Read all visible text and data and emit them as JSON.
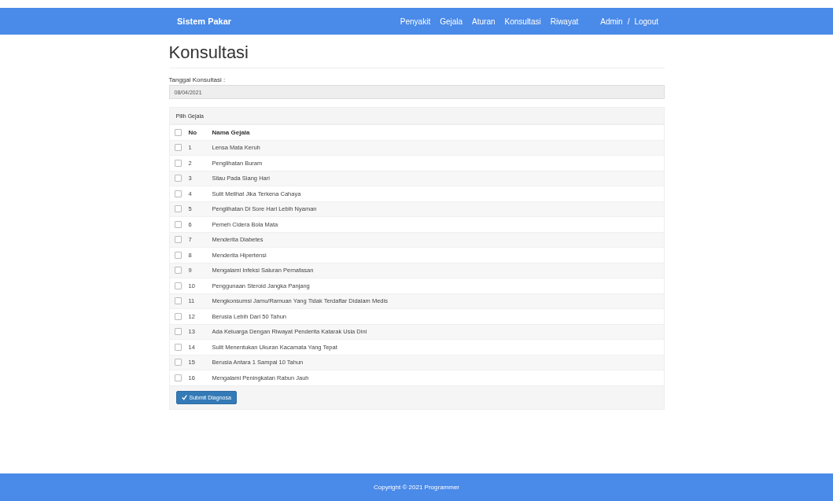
{
  "navbar": {
    "brand": "Sistem Pakar",
    "links": [
      "Penyakit",
      "Gejala",
      "Aturan",
      "Konsultasi",
      "Riwayat"
    ],
    "user": "Admin",
    "separator": "/",
    "logout": "Logout"
  },
  "page": {
    "title": "Konsultasi",
    "date_label": "Tanggal Konsultasi :",
    "date_value": "08/04/2021"
  },
  "panel": {
    "heading": "Pilih Gejala",
    "columns": [
      "No",
      "Nama Gejala"
    ],
    "all_checked": false,
    "rows": [
      {
        "no": "1",
        "name": "Lensa Mata Keruh",
        "checked": false
      },
      {
        "no": "2",
        "name": "Penglihatan Buram",
        "checked": false
      },
      {
        "no": "3",
        "name": "Silau Pada Siang Hari",
        "checked": false
      },
      {
        "no": "4",
        "name": "Sulit Melihat Jika Terkena Cahaya",
        "checked": false
      },
      {
        "no": "5",
        "name": "Penglihatan Di Sore Hari Lebih Nyaman",
        "checked": false
      },
      {
        "no": "6",
        "name": "Pemeh Cidera Bola Mata",
        "checked": false
      },
      {
        "no": "7",
        "name": "Menderita Diabetes",
        "checked": false
      },
      {
        "no": "8",
        "name": "Menderita Hipertensi",
        "checked": false
      },
      {
        "no": "9",
        "name": "Mengalami Infeksi Saluran Pernafasan",
        "checked": false
      },
      {
        "no": "10",
        "name": "Penggunaan Steroid Jangka Panjang",
        "checked": false
      },
      {
        "no": "11",
        "name": "Mengkonsumsi Jamu/Ramuan Yang Tidak Terdaftar Didalam Medis",
        "checked": false
      },
      {
        "no": "12",
        "name": "Berusia Lebih Dari 50 Tahun",
        "checked": false
      },
      {
        "no": "13",
        "name": "Ada Keluarga Dengan Riwayat Penderita Katarak Usia Dini",
        "checked": false
      },
      {
        "no": "14",
        "name": "Sulit Menentukan Ukuran Kacamata Yang Tepat",
        "checked": false
      },
      {
        "no": "15",
        "name": "Berusia Antara 1 Sampai 10 Tahun",
        "checked": false
      },
      {
        "no": "16",
        "name": "Mengalami Peningkatan Rabun Jauh",
        "checked": false
      }
    ],
    "submit": "Submit Diagnosa"
  },
  "footer": {
    "text": "Copyright © 2021 Programmer"
  }
}
